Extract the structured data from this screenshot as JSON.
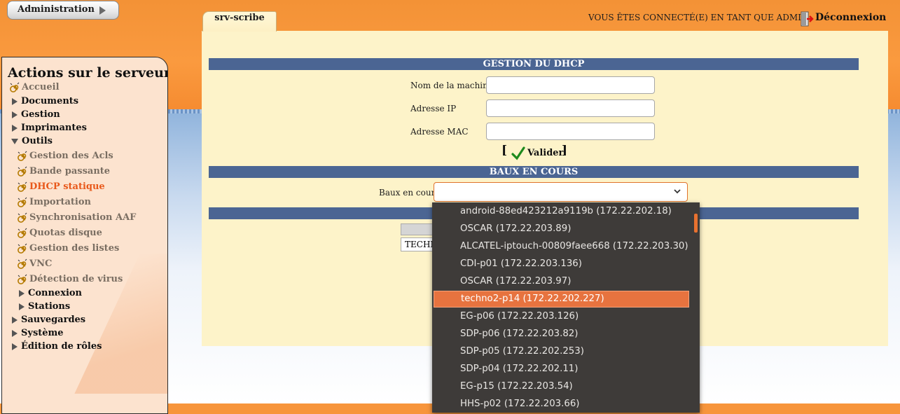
{
  "header": {
    "admin_button": "Administration",
    "tab": "srv-scribe",
    "connected_text": "VOUS ÊTES CONNECTÉ(E) EN TANT QUE ADMIN",
    "logout": "Déconnexion"
  },
  "sidebar": {
    "title": "Actions sur le serveur",
    "accueil": "Accueil",
    "documents": "Documents",
    "gestion": "Gestion",
    "imprimantes": "Imprimantes",
    "outils": "Outils",
    "outils_items": [
      "Gestion des Acls",
      "Bande passante",
      "DHCP statique",
      "Importation",
      "Synchronisation AAF",
      "Quotas disque",
      "Gestion des listes",
      "VNC",
      "Détection de virus"
    ],
    "connexion": "Connexion",
    "stations": "Stations",
    "sauvegardes": "Sauvegardes",
    "systeme": "Système",
    "edition_roles": "Édition de rôles",
    "active_item": "DHCP statique"
  },
  "form": {
    "section_title": "GESTION DU DHCP",
    "nom_label": "Nom de la machine",
    "nom_value": "",
    "ip_label": "Adresse IP",
    "ip_value": "",
    "mac_label": "Adresse MAC",
    "mac_value": "",
    "validate_open": "[",
    "validate_label": "Valider",
    "validate_close": "]"
  },
  "leases": {
    "section_title": "BAUX EN COURS",
    "select_label": "Baux en cours",
    "selected_value": "",
    "behind_field_text": "TECHN",
    "options": [
      "android-88ed423212a9119b (172.22.202.18)",
      "OSCAR (172.22.203.89)",
      "ALCATEL-iptouch-00809faee668 (172.22.203.30)",
      "CDI-p01 (172.22.203.136)",
      "OSCAR (172.22.203.97)",
      "techno2-p14 (172.22.202.227)",
      "EG-p06 (172.22.203.126)",
      "SDP-p06 (172.22.203.82)",
      "SDP-p05 (172.22.202.253)",
      "SDP-p04 (172.22.202.11)",
      "EG-p15 (172.22.203.54)",
      "HHS-p02 (172.22.203.66)"
    ],
    "highlighted_option": "techno2-p14 (172.22.202.227)"
  },
  "colors": {
    "orange_bg": "#f7953b",
    "section_bar": "#4b6593",
    "active_link": "#e8581a",
    "dropdown_bg": "#3e3b39",
    "dropdown_highlight": "#e7733f"
  }
}
